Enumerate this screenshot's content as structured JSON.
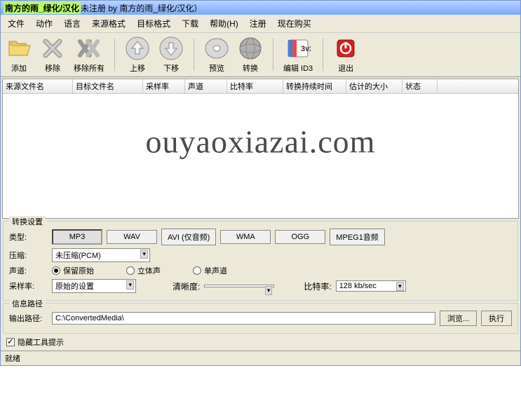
{
  "title": {
    "highlight": "南方的雨_绿化/汉化",
    "rest": "未注册 by 南方的雨_绿化/汉化）"
  },
  "menu": {
    "file": "文件",
    "action": "动作",
    "lang": "语言",
    "src_fmt": "来源格式",
    "tgt_fmt": "目标格式",
    "download": "下载",
    "help": "帮助(H)",
    "reg": "注册",
    "buy": "现在购买"
  },
  "toolbar": {
    "add": "添加",
    "remove": "移除",
    "remove_all": "移除所有",
    "up": "上移",
    "down": "下移",
    "preview": "预览",
    "convert": "转换",
    "edit_id3": "编辑 ID3",
    "exit": "退出"
  },
  "columns": {
    "src": "来源文件名",
    "tgt": "目标文件名",
    "sample": "采样率",
    "channel": "声道",
    "bitrate": "比特率",
    "duration": "转换持续时间",
    "size": "估计的大小",
    "status": "状态"
  },
  "watermark": "ouyaoxiazai.com",
  "grp_convert": "转换设置",
  "type_label": "类型:",
  "types": {
    "mp3": "MP3",
    "wav": "WAV",
    "avi": "AVI (仅音频)",
    "wma": "WMA",
    "ogg": "OGG",
    "mpeg1": "MPEG1音频"
  },
  "compress_label": "压缩:",
  "compress_value": "未压缩(PCM)",
  "channel_label": "声道:",
  "channels": {
    "orig": "保留原始",
    "stereo": "立体声",
    "mono": "单声道"
  },
  "sample_label": "采样率:",
  "sample_value": "原始的设置",
  "clarity_label": "清晰度:",
  "bitrate_label": "比特率:",
  "bitrate_value": "128 kb/sec",
  "grp_path": "信息路径",
  "output_label": "输出路径:",
  "output_value": "C:\\ConvertedMedia\\",
  "browse": "浏览...",
  "execute": "执行",
  "hide_tips": "隐藏工具提示",
  "status": "就绪"
}
